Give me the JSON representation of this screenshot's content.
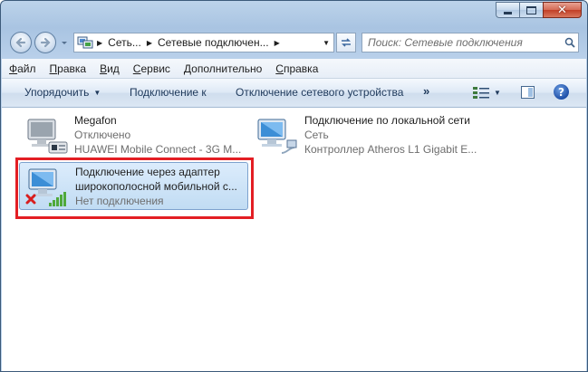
{
  "window": {
    "caption": {
      "minimize": "–",
      "maximize": "□",
      "close": "✕"
    }
  },
  "address": {
    "crumbs": [
      "Сеть...",
      "Сетевые подключен..."
    ]
  },
  "search": {
    "placeholder": "Поиск: Сетевые подключения"
  },
  "menu": [
    {
      "label": "Файл",
      "key": "Ф",
      "rest": "айл"
    },
    {
      "label": "Правка",
      "key": "П",
      "rest": "равка"
    },
    {
      "label": "Вид",
      "key": "В",
      "rest": "ид"
    },
    {
      "label": "Сервис",
      "key": "С",
      "rest": "ервис"
    },
    {
      "label": "Дополнительно",
      "key": "Д",
      "rest": "ополнительно"
    },
    {
      "label": "Справка",
      "key": "С",
      "rest": "правка"
    }
  ],
  "commands": {
    "organize": "Упорядочить",
    "connect": "Подключение к",
    "disconnect": "Отключение сетевого устройства",
    "more": "»"
  },
  "connections": [
    {
      "name": "Megafon",
      "status": "Отключено",
      "device": "HUAWEI Mobile Connect - 3G M..."
    },
    {
      "name": "Подключение по локальной сети",
      "status": "Сеть",
      "device": "Контроллер Atheros L1 Gigabit E..."
    },
    {
      "name": "Подключение через адаптер",
      "name2": "широкополосной мобильной с...",
      "status": "Нет подключения",
      "selected": true
    }
  ],
  "colors": {
    "highlight": "#e31e24",
    "selection": "#c1dcf3",
    "titlebar": "#a9c4e2"
  }
}
